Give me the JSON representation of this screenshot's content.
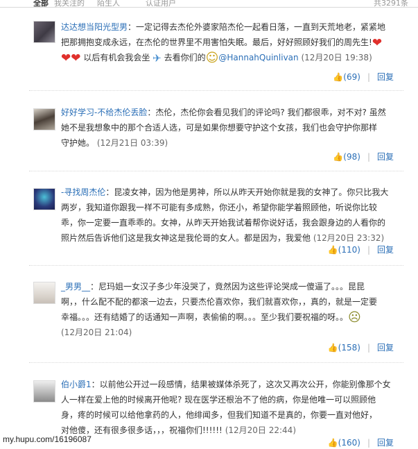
{
  "topbar": {
    "tab1": "全部",
    "tab2": "我关注的",
    "tab3": "陌生人",
    "tab4": "认证用户",
    "count": "共3291条"
  },
  "comments": [
    {
      "user": "达达想当阳光型男",
      "lines": [
        "：一定记得去杰伦外婆家陪杰伦一起看日落，一直到天荒地老，紧紧地",
        "把那拥抱变成永远，在杰伦的世界里不用害怕失眠。最后，好好照顾好我们的周先生!"
      ],
      "tail_text": "以后有机会我会坐",
      "tail_text2": "去看你们的",
      "mention": "@HannahQuinlivan",
      "time": "(12月20日 19:38)",
      "likes": "(69)",
      "reply": "回复"
    },
    {
      "user": "好好学习-不给杰伦丢脸",
      "lines": [
        "：杰伦，杰伦你会看见我们的评论吗? 我们都很乖，对不对? 虽然",
        "她不是我想象中的那个合适人选，可是如果你想要守护这个女孩，我们也会守护你那样",
        "守护她。"
      ],
      "time": "(12月21日 03:39)",
      "likes": "(98)",
      "reply": "回复"
    },
    {
      "user": "-寻找周杰伦",
      "lines": [
        "：昆凌女神，因为他是男神，所以从昨天开始你就是我的女神了。你只比我大",
        "两岁，我知道你跟我一样不可能有多成熟，你还小，希望你能学着照顾他，听说你比较",
        "乖，你一定要一直乖乖的。女神，从昨天开始我试着帮你说好话，我会跟身边的人看你的",
        "照片然后告诉他们这是我女神这是我伦哥的女人。都是因为，我爱他"
      ],
      "time": "(12月20日 23:32)",
      "likes": "(110)",
      "reply": "回复"
    },
    {
      "user": "_男男__",
      "lines": [
        "：尼玛姐一女汉子多少年没哭了，竟然因为这些评论哭成一傻逼了。。。昆昆",
        "啊，，什么配不配的都滚一边去，只要杰伦喜欢你，我们就喜欢你，，真的，就是一定要",
        "幸福。。。还有结婚了的话通知一声啊，表偷偷的啊。。。至少我们要祝福的呀。。"
      ],
      "time": "(12月20日 21:04)",
      "likes": "(158)",
      "reply": "回复"
    },
    {
      "user": "伯小爵1",
      "lines": [
        "：以前他公开过一段感情，结果被媒体杀死了，这次又再次公开，你能别像那个女",
        "人一样在爱上他的时候离开他呢? 现在医学还根治不了他的病，你是他唯一可以照顾他",
        "身，疼的时候可以给他拿药的人，他绯闻多，但我们知道不是真的，你要一直对他好，",
        "对他傻，还有很多很多话，，，祝福你们!!!!!!"
      ],
      "time": "(12月20日 22:44)",
      "likes": "(160)",
      "reply": "回复"
    }
  ],
  "watermark": "my.hupu.com/16196087"
}
